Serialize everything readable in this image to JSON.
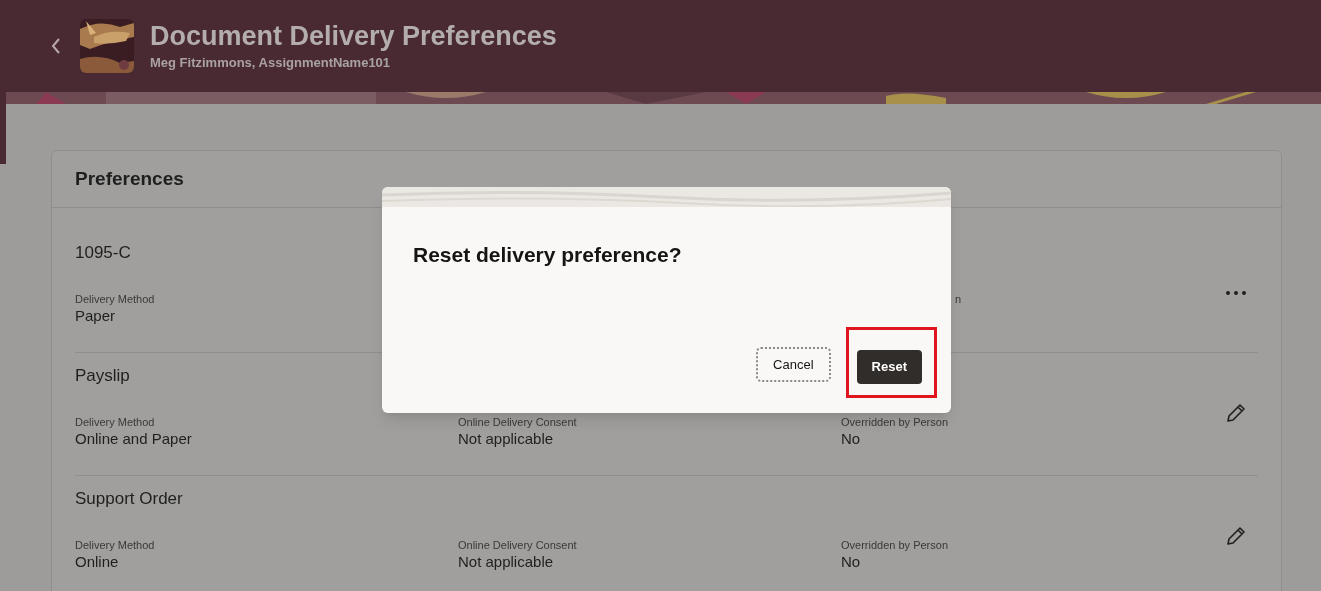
{
  "header": {
    "title": "Document Delivery Preferences",
    "subtitle": "Meg Fitzimmons, AssignmentName101"
  },
  "preferences": {
    "title": "Preferences",
    "items": [
      {
        "name": "1095-C",
        "kind": "more",
        "fields": [
          {
            "label": "Delivery Method",
            "value": "Paper"
          },
          {
            "label": "n"
          }
        ]
      },
      {
        "name": "Payslip",
        "kind": "edit",
        "fields": [
          {
            "label": "Delivery Method",
            "value": "Online and Paper"
          },
          {
            "label": "Online Delivery Consent",
            "value": "Not applicable"
          },
          {
            "label": "Overridden by Person",
            "value": "No"
          }
        ]
      },
      {
        "name": "Support Order",
        "kind": "edit",
        "fields": [
          {
            "label": "Delivery Method",
            "value": "Online"
          },
          {
            "label": "Online Delivery Consent",
            "value": "Not applicable"
          },
          {
            "label": "Overridden by Person",
            "value": "No"
          }
        ]
      }
    ]
  },
  "dialog": {
    "title": "Reset delivery preference?",
    "buttons": [
      {
        "label": "Cancel",
        "kind": "secondary",
        "highlighted": false
      },
      {
        "label": "Reset",
        "kind": "primary",
        "highlighted": true
      }
    ]
  }
}
